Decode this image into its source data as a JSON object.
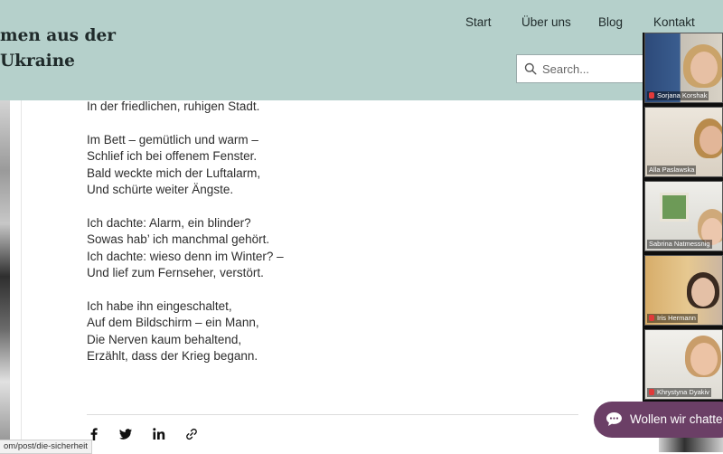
{
  "header": {
    "site_title_line1": "men aus der",
    "site_title_line2": "Ukraine",
    "nav": [
      "Start",
      "Über uns",
      "Blog",
      "Kontakt"
    ]
  },
  "search": {
    "placeholder": "Search..."
  },
  "poem": {
    "line_top": "In der friedlichen, ruhigen Stadt.",
    "stanzas": [
      [
        "Im Bett – gemütlich und warm –",
        "Schlief ich bei offenem Fenster.",
        "Bald weckte mich der Luftalarm,",
        "Und schürte weiter Ängste."
      ],
      [
        "Ich dachte: Alarm, ein blinder?",
        "Sowas hab’ ich manchmal gehört.",
        "Ich dachte: wieso denn im Winter? –",
        "Und lief zum Fernseher, verstört."
      ],
      [
        "Ich habe ihn eingeschaltet,",
        "Auf dem Bildschirm – ein Mann,",
        "Die Nerven kaum behaltend,",
        "Erzählt, dass der Krieg begann."
      ]
    ]
  },
  "share": {
    "icons": [
      "facebook-icon",
      "twitter-icon",
      "linkedin-icon",
      "link-icon"
    ]
  },
  "status_url": "om/post/die-sicherheit",
  "video_call": {
    "participants": [
      {
        "name": "Sorjana Korshak",
        "muted": true
      },
      {
        "name": "Alla Paslawska",
        "muted": false
      },
      {
        "name": "Sabrina Natmessnig",
        "muted": false
      },
      {
        "name": "Iris Hermann",
        "muted": true
      },
      {
        "name": "Khrystyna Dyakiv",
        "muted": true
      }
    ]
  },
  "chat": {
    "label": "Wollen wir chatten?"
  },
  "colors": {
    "header_bg": "#b5d0cb",
    "chat_bg": "#6b3f66"
  }
}
